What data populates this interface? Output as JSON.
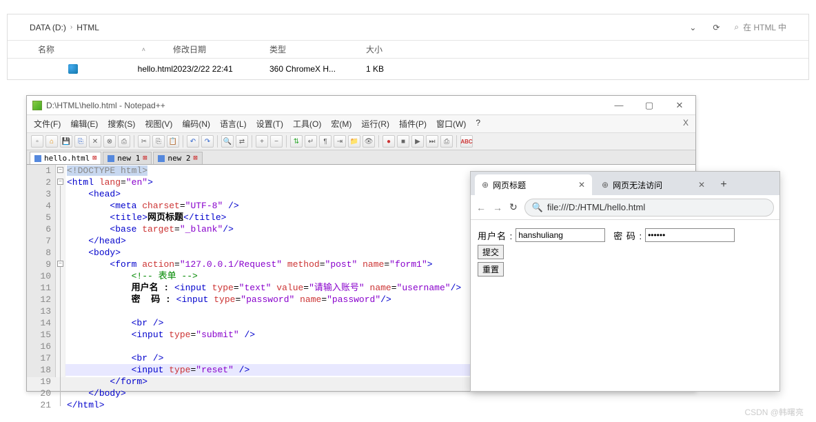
{
  "explorer": {
    "path_root": "DATA (D:)",
    "path_sep": "›",
    "path_folder": "HTML",
    "dropdown_icon": "⌄",
    "refresh_icon": "⟳",
    "search_icon": "⌕",
    "search_placeholder": "在 HTML 中",
    "cols": {
      "name": "名称",
      "date": "修改日期",
      "type": "类型",
      "size": "大小"
    },
    "file": {
      "name": "hello.html",
      "date": "2023/2/22 22:41",
      "type": "360 ChromeX H...",
      "size": "1 KB"
    }
  },
  "npp": {
    "title": "D:\\HTML\\hello.html - Notepad++",
    "menu": [
      "文件(F)",
      "编辑(E)",
      "搜索(S)",
      "视图(V)",
      "编码(N)",
      "语言(L)",
      "设置(T)",
      "工具(O)",
      "宏(M)",
      "运行(R)",
      "插件(P)",
      "窗口(W)",
      "?"
    ],
    "menu_close": "X",
    "tabs": [
      {
        "label": "hello.html",
        "active": true,
        "dirty": true
      },
      {
        "label": "new 1",
        "active": false,
        "dirty": true
      },
      {
        "label": "new 2",
        "active": false,
        "dirty": true
      }
    ],
    "lines": 21,
    "code": {
      "l1": "<!DOCTYPE html>",
      "l2_open": "<html ",
      "l2_attr": "lang",
      "l2_eq": "=",
      "l2_val": "\"en\"",
      "l2_close": ">",
      "l3": "<head>",
      "l4a": "<meta ",
      "l4b": "charset",
      "l4c": "=",
      "l4d": "\"UTF-8\"",
      "l4e": " />",
      "l5a": "<title>",
      "l5b": "网页标题",
      "l5c": "</title>",
      "l6a": "<base ",
      "l6b": "target",
      "l6c": "=",
      "l6d": "\"_blank\"",
      "l6e": "/>",
      "l7": "</head>",
      "l8": "<body>",
      "l9a": "<form ",
      "l9b": "action",
      "l9c": "=",
      "l9d": "\"127.0.0.1/Request\"",
      "l9e": " method",
      "l9f": "=",
      "l9g": "\"post\"",
      "l9h": " name",
      "l9i": "=",
      "l9j": "\"form1\"",
      "l9k": ">",
      "l10": "<!-- 表单 -->",
      "l11a": "用户名 : ",
      "l11b": "<input ",
      "l11c": "type",
      "l11d": "=",
      "l11e": "\"text\"",
      "l11f": " value",
      "l11g": "=",
      "l11h": "\"请输入账号\"",
      "l11i": " name",
      "l11j": "=",
      "l11k": "\"username\"",
      "l11l": "/>",
      "l12a": "密  码 : ",
      "l12b": "<input ",
      "l12c": "type",
      "l12d": "=",
      "l12e": "\"password\"",
      "l12f": " name",
      "l12g": "=",
      "l12h": "\"password\"",
      "l12i": "/>",
      "l14": "<br />",
      "l15a": "<input ",
      "l15b": "type",
      "l15c": "=",
      "l15d": "\"submit\"",
      "l15e": " />",
      "l17": "<br />",
      "l18a": "<input ",
      "l18b": "type",
      "l18c": "=",
      "l18d": "\"reset\"",
      "l18e": " />",
      "l19": "</form>",
      "l20": "</body>",
      "l21": "</html>"
    }
  },
  "browser": {
    "tabs": [
      {
        "title": "网页标题",
        "active": true
      },
      {
        "title": "网页无法访问",
        "active": false
      }
    ],
    "url": "file:///D:/HTML/hello.html",
    "nav": {
      "back": "←",
      "fwd": "→",
      "reload": "↻",
      "search": "🔍",
      "plus": "+"
    },
    "form": {
      "user_label": "用户名 :",
      "user_value": "hanshuliang",
      "pw_label": "密  码 :",
      "pw_value": "••••••",
      "submit": "提交",
      "reset": "重置"
    }
  },
  "watermark": "CSDN @韩曙亮"
}
